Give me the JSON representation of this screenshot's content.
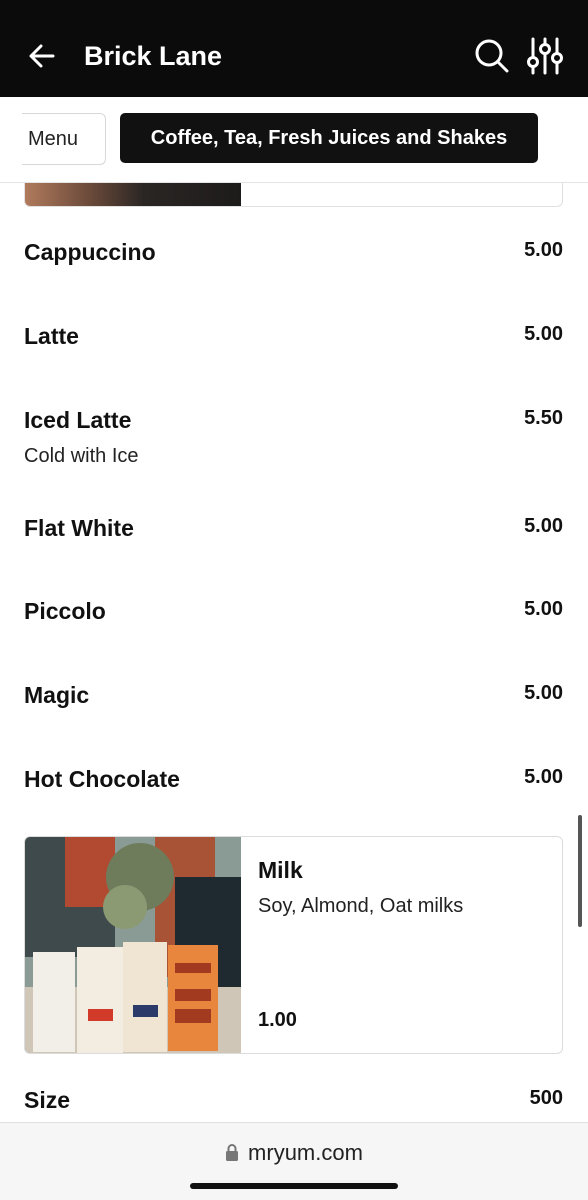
{
  "header": {
    "title": "Brick Lane"
  },
  "tabs": [
    {
      "label": "Menu"
    },
    {
      "label": "Coffee, Tea, Fresh Juices and Shakes"
    }
  ],
  "items": [
    {
      "name": "Cappuccino",
      "price": "5.00",
      "description": ""
    },
    {
      "name": "Latte",
      "price": "5.00",
      "description": ""
    },
    {
      "name": "Iced Latte",
      "price": "5.50",
      "description": "Cold with Ice"
    },
    {
      "name": "Flat White",
      "price": "5.00",
      "description": ""
    },
    {
      "name": "Piccolo",
      "price": "5.00",
      "description": ""
    },
    {
      "name": "Magic",
      "price": "5.00",
      "description": ""
    },
    {
      "name": "Hot Chocolate",
      "price": "5.00",
      "description": ""
    }
  ],
  "milk": {
    "name": "Milk",
    "description": "Soy, Almond, Oat milks",
    "price": "1.00"
  },
  "size": {
    "name": "Size",
    "price": "500"
  },
  "browser": {
    "url": "mryum.com"
  },
  "colors": {
    "header_bg": "#0b0b0b",
    "tab_active_bg": "#111111"
  },
  "icons": [
    "back-arrow-icon",
    "search-icon",
    "filter-sliders-icon",
    "lock-icon"
  ]
}
